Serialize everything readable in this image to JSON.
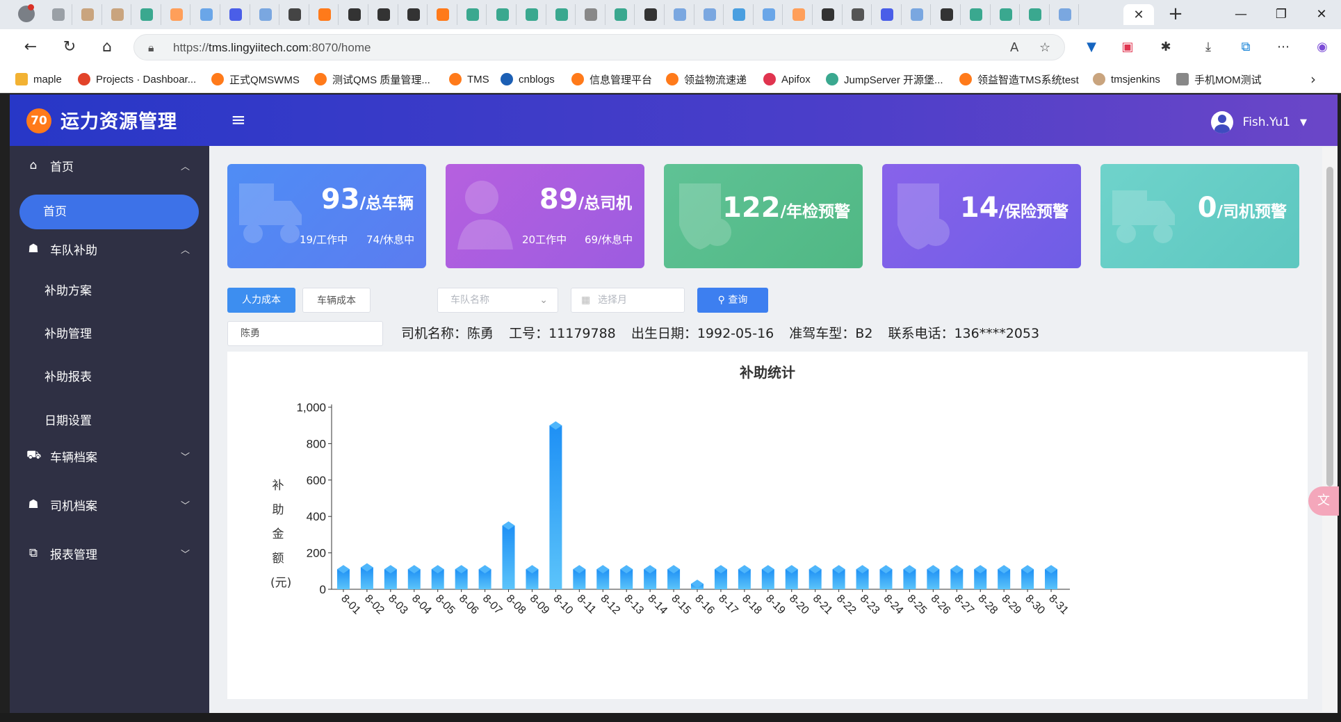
{
  "browser": {
    "url_scheme": "https://",
    "url_host": "tms.lingyiitech.com",
    "url_rest": ":8070/home",
    "bookmarks": [
      {
        "label": "maple",
        "icon": "folder-icon",
        "color": "#f2b233"
      },
      {
        "label": "Projects · Dashboar...",
        "icon": "gitlab-icon",
        "color": "#e24329"
      },
      {
        "label": "正式QMSWMS",
        "icon": "app-icon",
        "color": "#ff7a1a"
      },
      {
        "label": "测试QMS 质量管理...",
        "icon": "app-icon",
        "color": "#ff7a1a"
      },
      {
        "label": "TMS",
        "icon": "app-icon",
        "color": "#ff7a1a"
      },
      {
        "label": "cnblogs",
        "icon": "cnblogs-icon",
        "color": "#1c5fb4"
      },
      {
        "label": "信息管理平台",
        "icon": "app-icon",
        "color": "#ff7a1a"
      },
      {
        "label": "领益物流速递",
        "icon": "app-icon",
        "color": "#ff7a1a"
      },
      {
        "label": "Apifox",
        "icon": "apifox-icon",
        "color": "#e0344f"
      },
      {
        "label": "JumpServer 开源堡...",
        "icon": "jumpserver-icon",
        "color": "#3aa88f"
      },
      {
        "label": "领益智造TMS系统test",
        "icon": "app-icon",
        "color": "#ff7a1a"
      },
      {
        "label": "tmsjenkins",
        "icon": "jenkins-icon",
        "color": "#c9a47e"
      },
      {
        "label": "手机MOM测试",
        "icon": "page-icon",
        "color": "#888888"
      }
    ]
  },
  "app": {
    "brand": "运力资源管理",
    "logo_text": "70",
    "user": "Fish.Yu1",
    "accent": "#3d72e8"
  },
  "sidebar": {
    "items": [
      {
        "label": "首页",
        "icon": "home-icon",
        "expanded": true
      },
      {
        "label": "车队补助",
        "icon": "user-icon",
        "expanded": true
      },
      {
        "label": "车辆档案",
        "icon": "truck-icon",
        "expanded": false
      },
      {
        "label": "司机档案",
        "icon": "user-icon",
        "expanded": false
      },
      {
        "label": "报表管理",
        "icon": "report-icon",
        "expanded": false
      }
    ],
    "home_sub": "首页",
    "subsidy_subs": [
      "补助方案",
      "补助管理",
      "补助报表",
      "日期设置"
    ]
  },
  "stats": [
    {
      "value": "93",
      "unit": "/总车辆",
      "sub1": "19/工作中",
      "sub2": "74/休息中",
      "color_from": "#4f8df5",
      "color_to": "#5b7cf0"
    },
    {
      "value": "89",
      "unit": "/总司机",
      "sub1": "20工作中",
      "sub2": "69/休息中",
      "color_from": "#b660df",
      "color_to": "#9c5ce0"
    },
    {
      "value": "122",
      "unit": "/年检预警",
      "color_from": "#5fc295",
      "color_to": "#50b884"
    },
    {
      "value": "14",
      "unit": "/保险预警",
      "color_from": "#8863ea",
      "color_to": "#6e5de6"
    },
    {
      "value": "0",
      "unit": "/司机预警",
      "color_from": "#6fd3cb",
      "color_to": "#5dc7c0"
    }
  ],
  "filters": {
    "tab_labor": "人力成本",
    "tab_vehicle": "车辆成本",
    "team_placeholder": "车队名称",
    "month_placeholder": "选择月",
    "query_label": "查询",
    "driver_input": "陈勇"
  },
  "driver": {
    "name": "司机名称：陈勇",
    "id": "工号：11179788",
    "birth": "出生日期：1992-05-16",
    "license": "准驾车型：B2",
    "phone": "联系电话：136****2053"
  },
  "chart_data": {
    "type": "bar",
    "title": "补助统计",
    "ylabel": "补助金额(元)",
    "ylabel_chars": [
      "补",
      "助",
      "金",
      "额",
      "(元)"
    ],
    "ylim": [
      0,
      1000
    ],
    "yticks": [
      0,
      200,
      400,
      600,
      800,
      1000
    ],
    "ytick_labels": [
      "0",
      "200",
      "400",
      "600",
      "800",
      "1,000"
    ],
    "categories": [
      "8-01",
      "8-02",
      "8-03",
      "8-04",
      "8-05",
      "8-06",
      "8-07",
      "8-08",
      "8-09",
      "8-10",
      "8-11",
      "8-12",
      "8-13",
      "8-14",
      "8-15",
      "8-16",
      "8-17",
      "8-18",
      "8-19",
      "8-20",
      "8-21",
      "8-22",
      "8-23",
      "8-24",
      "8-25",
      "8-26",
      "8-27",
      "8-28",
      "8-29",
      "8-30",
      "8-31"
    ],
    "values": [
      110,
      120,
      110,
      110,
      110,
      110,
      110,
      350,
      110,
      900,
      110,
      110,
      110,
      110,
      110,
      30,
      110,
      110,
      110,
      110,
      110,
      110,
      110,
      110,
      110,
      110,
      110,
      110,
      110,
      110,
      110
    ],
    "bar_color_top": "#1e90f5",
    "bar_color_bottom": "#5cc4fa",
    "grid": false
  }
}
